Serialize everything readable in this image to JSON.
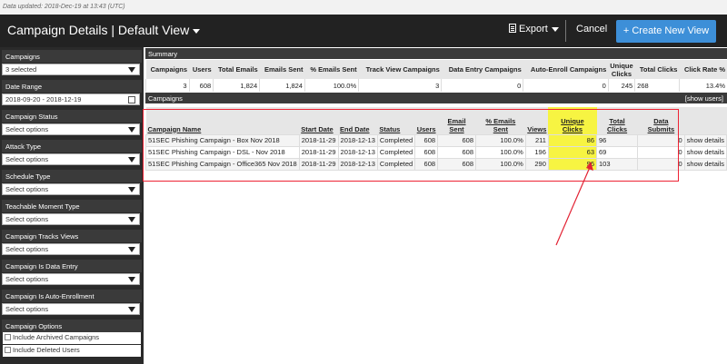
{
  "updated": "Data updated: 2018-Dec-19 at 13:43 (UTC)",
  "header": {
    "title": "Campaign Details | Default View",
    "export": "Export",
    "cancel": "Cancel",
    "create": "+ Create New View"
  },
  "sidebar": {
    "campaigns_label": "Campaigns",
    "campaigns_value": "3 selected",
    "date_label": "Date Range",
    "date_value": "2018-09-20 - 2018-12-19",
    "status_label": "Campaign Status",
    "attack_label": "Attack Type",
    "schedule_label": "Schedule Type",
    "moment_label": "Teachable Moment Type",
    "tracks_label": "Campaign Tracks Views",
    "dataentry_label": "Campaign Is Data Entry",
    "autoenroll_label": "Campaign Is Auto-Enrollment",
    "options_label": "Campaign Options",
    "select_placeholder": "Select options",
    "opt_archived": "Include Archived Campaigns",
    "opt_deleted": "Include Deleted Users"
  },
  "summary": {
    "bar": "Summary",
    "headers": [
      "Campaigns",
      "Users",
      "Total Emails",
      "Emails Sent",
      "% Emails Sent",
      "Track View Campaigns",
      "Data Entry Campaigns",
      "Auto-Enroll Campaigns",
      "Unique Clicks",
      "Total Clicks",
      "Click Rate %"
    ],
    "values": [
      "3",
      "608",
      "1,824",
      "1,824",
      "100.0%",
      "3",
      "0",
      "0",
      "245",
      "268",
      "13.4%"
    ]
  },
  "campaigns": {
    "bar": "Campaigns",
    "show_users": "[show users]",
    "headers": [
      "Campaign Name",
      "Start Date",
      "End Date",
      "Status",
      "Users",
      "Email Sent",
      "% Emails Sent",
      "Views",
      "Unique Clicks",
      "Total Clicks",
      "Data Submits",
      ""
    ],
    "rows": [
      [
        "51SEC Phishing Campaign - Box Nov 2018",
        "2018-11-29",
        "2018-12-13",
        "Completed",
        "608",
        "608",
        "100.0%",
        "211",
        "86",
        "96",
        "0",
        "show details"
      ],
      [
        "51SEC Phishing Campaign - DSL - Nov 2018",
        "2018-11-29",
        "2018-12-13",
        "Completed",
        "608",
        "608",
        "100.0%",
        "196",
        "63",
        "69",
        "0",
        "show details"
      ],
      [
        "51SEC Phishing Campaign - Office365 Nov 2018",
        "2018-11-29",
        "2018-12-13",
        "Completed",
        "608",
        "608",
        "100.0%",
        "290",
        "96",
        "103",
        "0",
        "show details"
      ]
    ]
  },
  "colors": {
    "topbar": "#222222",
    "accent": "#3d8fd8",
    "highlight": "#f7f442",
    "annotation": "#e22233"
  }
}
